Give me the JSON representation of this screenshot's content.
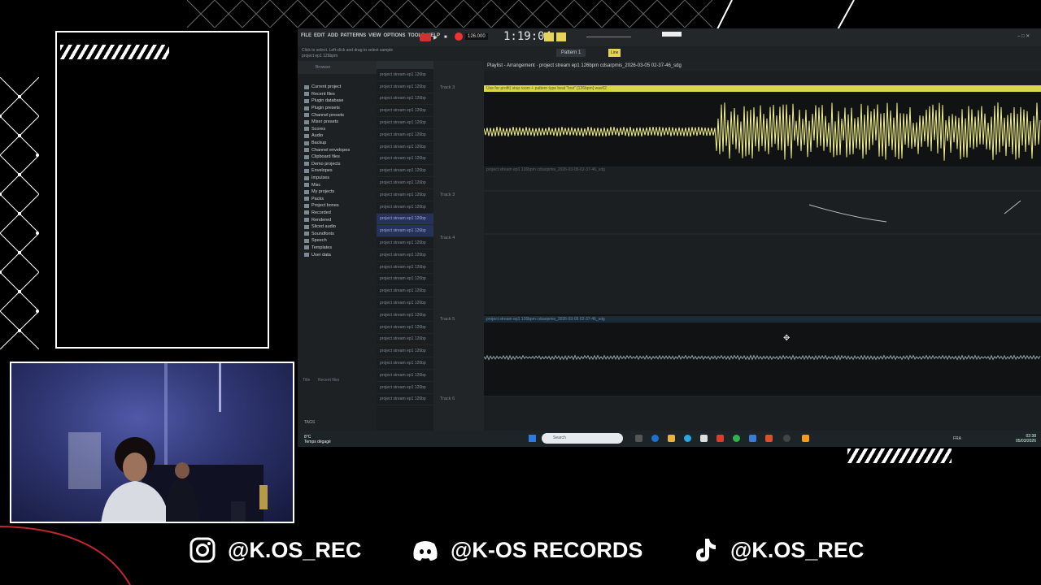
{
  "social": [
    {
      "handle": "@K.OS_REC",
      "icon": "instagram-icon"
    },
    {
      "handle": "@K-OS RECORDS",
      "icon": "discord-icon"
    },
    {
      "handle": "@K.OS_REC",
      "icon": "tiktok-icon"
    }
  ],
  "daw": {
    "menu": [
      "FILE",
      "EDIT",
      "ADD",
      "PATTERNS",
      "VIEW",
      "OPTIONS",
      "TOOLS",
      "HELP"
    ],
    "tempo": "126.000",
    "time": "1:19:04",
    "pattern": "Pattern 1",
    "snap": "Line",
    "hint_line1": "Click to select. Left-click and drag to select sample",
    "hint_line2": "project ep1 126bpm",
    "browser_title": "Browser",
    "browser_items": [
      "Current project",
      "Recent files",
      "Plugin database",
      "Plugin presets",
      "Channel presets",
      "Mixer presets",
      "Scores",
      "Audio",
      "Backup",
      "Channel envelopes",
      "Clipboard files",
      "Demo projects",
      "Envelopes",
      "Impulses",
      "Misc",
      "My projects",
      "Packs",
      "Project bones",
      "Recorded",
      "Rendered",
      "Sliced audio",
      "Soundfonts",
      "Speech",
      "Templates",
      "User data"
    ],
    "browser_footer": "Title",
    "browser_footer2": "Recent files",
    "tags_label": "TAGS",
    "file_item": "project stream ep1 126bp",
    "file_count_selected": [
      12,
      13
    ],
    "playlist_title": "Playlist - Arrangement · project stream ep1 126bpm cdsarpmis_2026-03-05 02-37-46_sdg",
    "tracks": [
      "Track 3",
      "Track 3",
      "Track 4",
      "Track 5",
      "Track 6"
    ],
    "clip1_label": "Use for profit) stop room + pattern type beat \"lost\" [126bpm] wav02",
    "clip2_label": "project stream ep1 126bpm cdsarpmis_2026-03-05-02-37-46_sdg",
    "clip3_label": "project stream ep1 126bpm cdsarpmis_2026-03-05 02-37-46_sdg",
    "weather_temp": "8°C",
    "weather_text": "Temps dégagé",
    "search": "Search",
    "clock_time": "02:38",
    "clock_date": "05/03/2026",
    "lang": "FRA"
  },
  "colors": {
    "accent": "#f2f08a",
    "clip_header": "#d9d64a",
    "audio_clip_bg": "#1a2a36"
  }
}
